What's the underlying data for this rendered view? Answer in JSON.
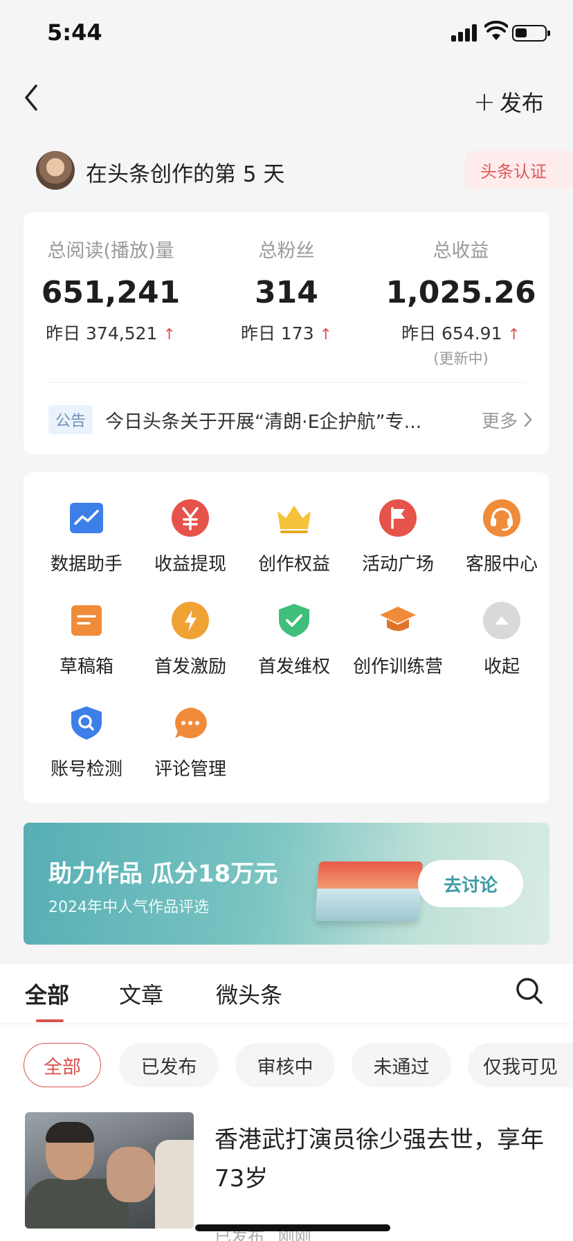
{
  "status_bar": {
    "time": "5:44"
  },
  "header": {
    "publish_label": "发布"
  },
  "user": {
    "creator_days": "在头条创作的第 5 天",
    "verify_label": "头条认证"
  },
  "stats": [
    {
      "label": "总阅读(播放)量",
      "value": "651,241",
      "yesterday": "昨日 374,521",
      "note": ""
    },
    {
      "label": "总粉丝",
      "value": "314",
      "yesterday": "昨日 173",
      "note": ""
    },
    {
      "label": "总收益",
      "value": "1,025.26",
      "yesterday": "昨日 654.91",
      "note": "(更新中)"
    }
  ],
  "notice": {
    "tag": "公告",
    "text": "今日头条关于开展“清朗·E企护航”专...",
    "more": "更多"
  },
  "tools": [
    {
      "label": "数据助手",
      "icon": "data-chart-icon"
    },
    {
      "label": "收益提现",
      "icon": "yuan-icon"
    },
    {
      "label": "创作权益",
      "icon": "crown-icon"
    },
    {
      "label": "活动广场",
      "icon": "flag-icon"
    },
    {
      "label": "客服中心",
      "icon": "headset-icon"
    },
    {
      "label": "草稿箱",
      "icon": "draft-icon"
    },
    {
      "label": "首发激励",
      "icon": "lightning-icon"
    },
    {
      "label": "首发维权",
      "icon": "shield-check-icon"
    },
    {
      "label": "创作训练营",
      "icon": "graduation-cap-icon"
    },
    {
      "label": "收起",
      "icon": "collapse-icon"
    },
    {
      "label": "账号检测",
      "icon": "shield-search-icon"
    },
    {
      "label": "评论管理",
      "icon": "comment-icon"
    }
  ],
  "banner": {
    "title": "助力作品 瓜分18万元",
    "subtitle": "2024年中人气作品评选",
    "button": "去讨论"
  },
  "tabs": [
    {
      "label": "全部"
    },
    {
      "label": "文章"
    },
    {
      "label": "微头条"
    }
  ],
  "filters": [
    {
      "label": "全部"
    },
    {
      "label": "已发布"
    },
    {
      "label": "审核中"
    },
    {
      "label": "未通过"
    },
    {
      "label": "仅我可见"
    }
  ],
  "article": {
    "title": "香港武打演员徐少强去世，享年73岁",
    "status": "已发布",
    "time": "刚刚"
  },
  "colors": {
    "accent": "#d9534f",
    "background": "#f5f5f5"
  }
}
